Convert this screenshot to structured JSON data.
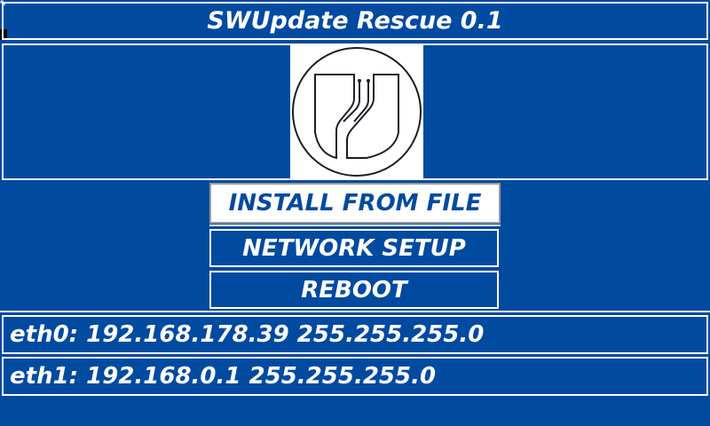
{
  "title": "SWUpdate Rescue 0.1",
  "logo": {
    "icon": "swupdate-logo-icon"
  },
  "menu": {
    "install_label": "INSTALL FROM FILE",
    "network_label": "NETWORK SETUP",
    "reboot_label": "REBOOT"
  },
  "interfaces": [
    {
      "text": "eth0: 192.168.178.39 255.255.255.0"
    },
    {
      "text": "eth1: 192.168.0.1 255.255.255.0"
    }
  ],
  "colors": {
    "background": "#004aa0",
    "foreground": "#ffffff",
    "selected_background": "#ffffff",
    "selected_text": "#004aa0"
  }
}
